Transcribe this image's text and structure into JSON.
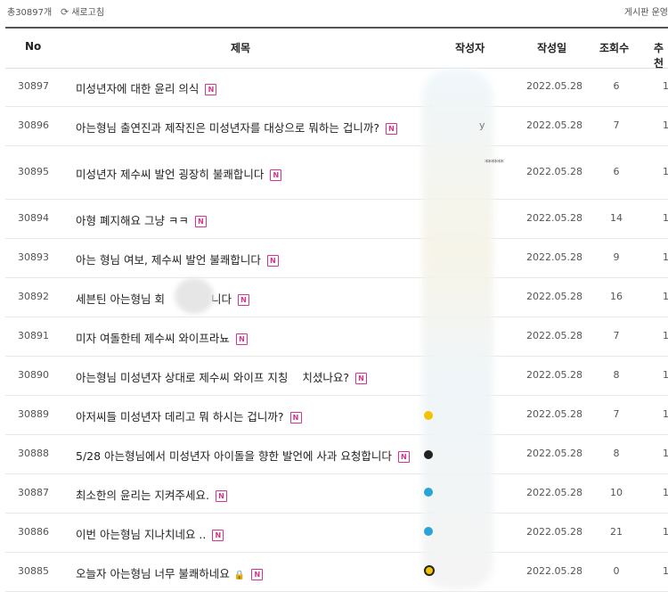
{
  "topbar": {
    "total": "총30897개",
    "refresh_label": "새로고침",
    "guide": "게시판 운영"
  },
  "columns": {
    "no": "No",
    "title": "제목",
    "author": "작성자",
    "date": "작성일",
    "views": "조회수",
    "recommend": "추천"
  },
  "posts": [
    {
      "no": "30897",
      "title": "미성년자에 대한 윤리 의식",
      "date": "2022.05.28",
      "views": "6",
      "rec": "1"
    },
    {
      "no": "30896",
      "title": "아는형님 출연진과 제작진은 미성년자를 대상으로 뭐하는 겁니까?",
      "date": "2022.05.28",
      "views": "7",
      "rec": "1"
    },
    {
      "no": "30895",
      "title": "미성년자 제수씨 발언 굉장히 불쾌합니다",
      "date": "2022.05.28",
      "views": "6",
      "rec": "1"
    },
    {
      "no": "30894",
      "title": "아형 폐지해요 그냥 ㅋㅋ",
      "date": "2022.05.28",
      "views": "14",
      "rec": "1"
    },
    {
      "no": "30893",
      "title": "아는 형님 여보, 제수씨 발언 불쾌합니다",
      "date": "2022.05.28",
      "views": "9",
      "rec": "1"
    },
    {
      "no": "30892",
      "title": "세븐틴 아는형님 회",
      "title_tail": "니다",
      "date": "2022.05.28",
      "views": "16",
      "rec": "1"
    },
    {
      "no": "30891",
      "title": "미자 여돌한테 제수씨 와이프라뇨",
      "date": "2022.05.28",
      "views": "7",
      "rec": "1"
    },
    {
      "no": "30890",
      "title": "아는형님 미성년자 상대로 제수씨 와이프 지칭",
      "title_tail": "치셨나요?",
      "date": "2022.05.28",
      "views": "8",
      "rec": "1"
    },
    {
      "no": "30889",
      "title": "아저씨들 미성년자 데리고 뭐 하시는 겁니까?",
      "date": "2022.05.28",
      "views": "7",
      "rec": "1"
    },
    {
      "no": "30888",
      "title": "5/28 아는형님에서 미성년자 아이돌을 향한 발언에 사과 요청합니다",
      "date": "2022.05.28",
      "views": "8",
      "rec": "1"
    },
    {
      "no": "30887",
      "title": "최소한의 윤리는 지켜주세요.",
      "date": "2022.05.28",
      "views": "10",
      "rec": "1"
    },
    {
      "no": "30886",
      "title": "이번 아는형님 지나치네요 ..",
      "date": "2022.05.28",
      "views": "21",
      "rec": "1"
    },
    {
      "no": "30885",
      "title": "오늘자 아는형님 너무 불쾌하네요",
      "date": "2022.05.28",
      "views": "0",
      "rec": "1",
      "locked": true
    }
  ],
  "icons": {
    "new_badge": "N",
    "accent_new": "#d6338a"
  }
}
